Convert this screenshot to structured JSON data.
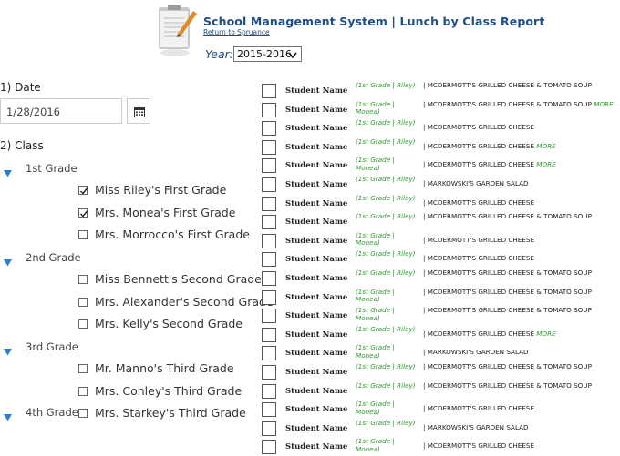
{
  "header": {
    "title": "School Management System | Lunch by Class Report",
    "return_link": "Return to Spruance",
    "year_label": "Year:",
    "year_value": "2015-2016",
    "icon": "notepad-pen-icon"
  },
  "filters": {
    "date_section": "1) Date",
    "date_value": "1/28/2016",
    "calendar_icon": "calendar-icon",
    "class_section": "2) Class",
    "grades": [
      {
        "label": "1st Grade",
        "classes": [
          {
            "label": "Miss Riley's First Grade",
            "checked": true
          },
          {
            "label": "Mrs. Monea's First Grade",
            "checked": true
          },
          {
            "label": "Mrs. Morrocco's First Grade",
            "checked": false
          }
        ]
      },
      {
        "label": "2nd Grade",
        "classes": [
          {
            "label": "Miss Bennett's Second Grade",
            "checked": false
          },
          {
            "label": "Mrs. Alexander's Second Grade",
            "checked": false
          },
          {
            "label": "Mrs. Kelly's Second Grade",
            "checked": false
          }
        ]
      },
      {
        "label": "3rd Grade",
        "classes": [
          {
            "label": "Mr. Manno's Third Grade",
            "checked": false
          },
          {
            "label": "Mrs. Conley's Third Grade",
            "checked": false
          },
          {
            "label": "Mrs. Starkey's Third Grade",
            "checked": false
          }
        ]
      },
      {
        "label": "4th Grade",
        "classes": []
      }
    ]
  },
  "report": {
    "more_label": "MORE",
    "rows": [
      {
        "student": "Student Name",
        "class": "(1st Grade | Riley)",
        "meal": "| MCDERMOTT'S GRILLED CHEESE & TOMATO SOUP",
        "more": false
      },
      {
        "student": "Student Name",
        "class": "(1st Grade | Monea)",
        "meal": "| MCDERMOTT'S GRILLED CHEESE & TOMATO SOUP",
        "more": true
      },
      {
        "student": "Student Name",
        "class": "(1st Grade | Riley)",
        "meal": "| MCDERMOTT'S GRILLED CHEESE",
        "more": false
      },
      {
        "student": "Student Name",
        "class": "(1st Grade | Riley)",
        "meal": "| MCDERMOTT'S GRILLED CHEESE",
        "more": true
      },
      {
        "student": "Student Name",
        "class": "(1st Grade | Monea)",
        "meal": "| MCDERMOTT'S GRILLED CHEESE",
        "more": true
      },
      {
        "student": "Student Name",
        "class": "(1st Grade | Riley)",
        "meal": "| MARKOWSKI'S GARDEN SALAD",
        "more": false
      },
      {
        "student": "Student Name",
        "class": "(1st Grade | Riley)",
        "meal": "| MCDERMOTT'S GRILLED CHEESE",
        "more": false
      },
      {
        "student": "Student Name",
        "class": "(1st Grade | Riley)",
        "meal": "| MCDERMOTT'S GRILLED CHEESE & TOMATO SOUP",
        "more": false
      },
      {
        "student": "Student Name",
        "class": "(1st Grade | Monea)",
        "meal": "| MCDERMOTT'S GRILLED CHEESE",
        "more": false
      },
      {
        "student": "Student Name",
        "class": "(1st Grade | Riley)",
        "meal": "| MCDERMOTT'S GRILLED CHEESE",
        "more": false
      },
      {
        "student": "Student Name",
        "class": "(1st Grade | Riley)",
        "meal": "| MCDERMOTT'S GRILLED CHEESE & TOMATO SOUP",
        "more": false
      },
      {
        "student": "Student Name",
        "class": "(1st Grade | Monea)",
        "meal": "| MCDERMOTT'S GRILLED CHEESE & TOMATO SOUP",
        "more": false
      },
      {
        "student": "Student Name",
        "class": "(1st Grade | Monea)",
        "meal": "| MCDERMOTT'S GRILLED CHEESE & TOMATO SOUP",
        "more": false
      },
      {
        "student": "Student Name",
        "class": "(1st Grade | Riley)",
        "meal": "| MCDERMOTT'S GRILLED CHEESE",
        "more": true
      },
      {
        "student": "Student Name",
        "class": "(1st Grade | Monea)",
        "meal": "| MARKOWSKI'S GARDEN SALAD",
        "more": false
      },
      {
        "student": "Student Name",
        "class": "(1st Grade | Riley)",
        "meal": "| MCDERMOTT'S GRILLED CHEESE & TOMATO SOUP",
        "more": false
      },
      {
        "student": "Student Name",
        "class": "(1st Grade | Riley)",
        "meal": "| MCDERMOTT'S GRILLED CHEESE & TOMATO SOUP",
        "more": false
      },
      {
        "student": "Student Name",
        "class": "(1st Grade | Monea)",
        "meal": "| MCDERMOTT'S GRILLED CHEESE",
        "more": false
      },
      {
        "student": "Student Name",
        "class": "(1st Grade | Riley)",
        "meal": "| MARKOWSKI'S GARDEN SALAD",
        "more": false
      },
      {
        "student": "Student Name",
        "class": "(1st Grade | Monea)",
        "meal": "| MCDERMOTT'S GRILLED CHEESE",
        "more": false
      }
    ]
  },
  "colors": {
    "title_blue": "#1f4e8c",
    "grade_triangle": "#2a7fd4",
    "class_green": "#2e9a2e"
  }
}
